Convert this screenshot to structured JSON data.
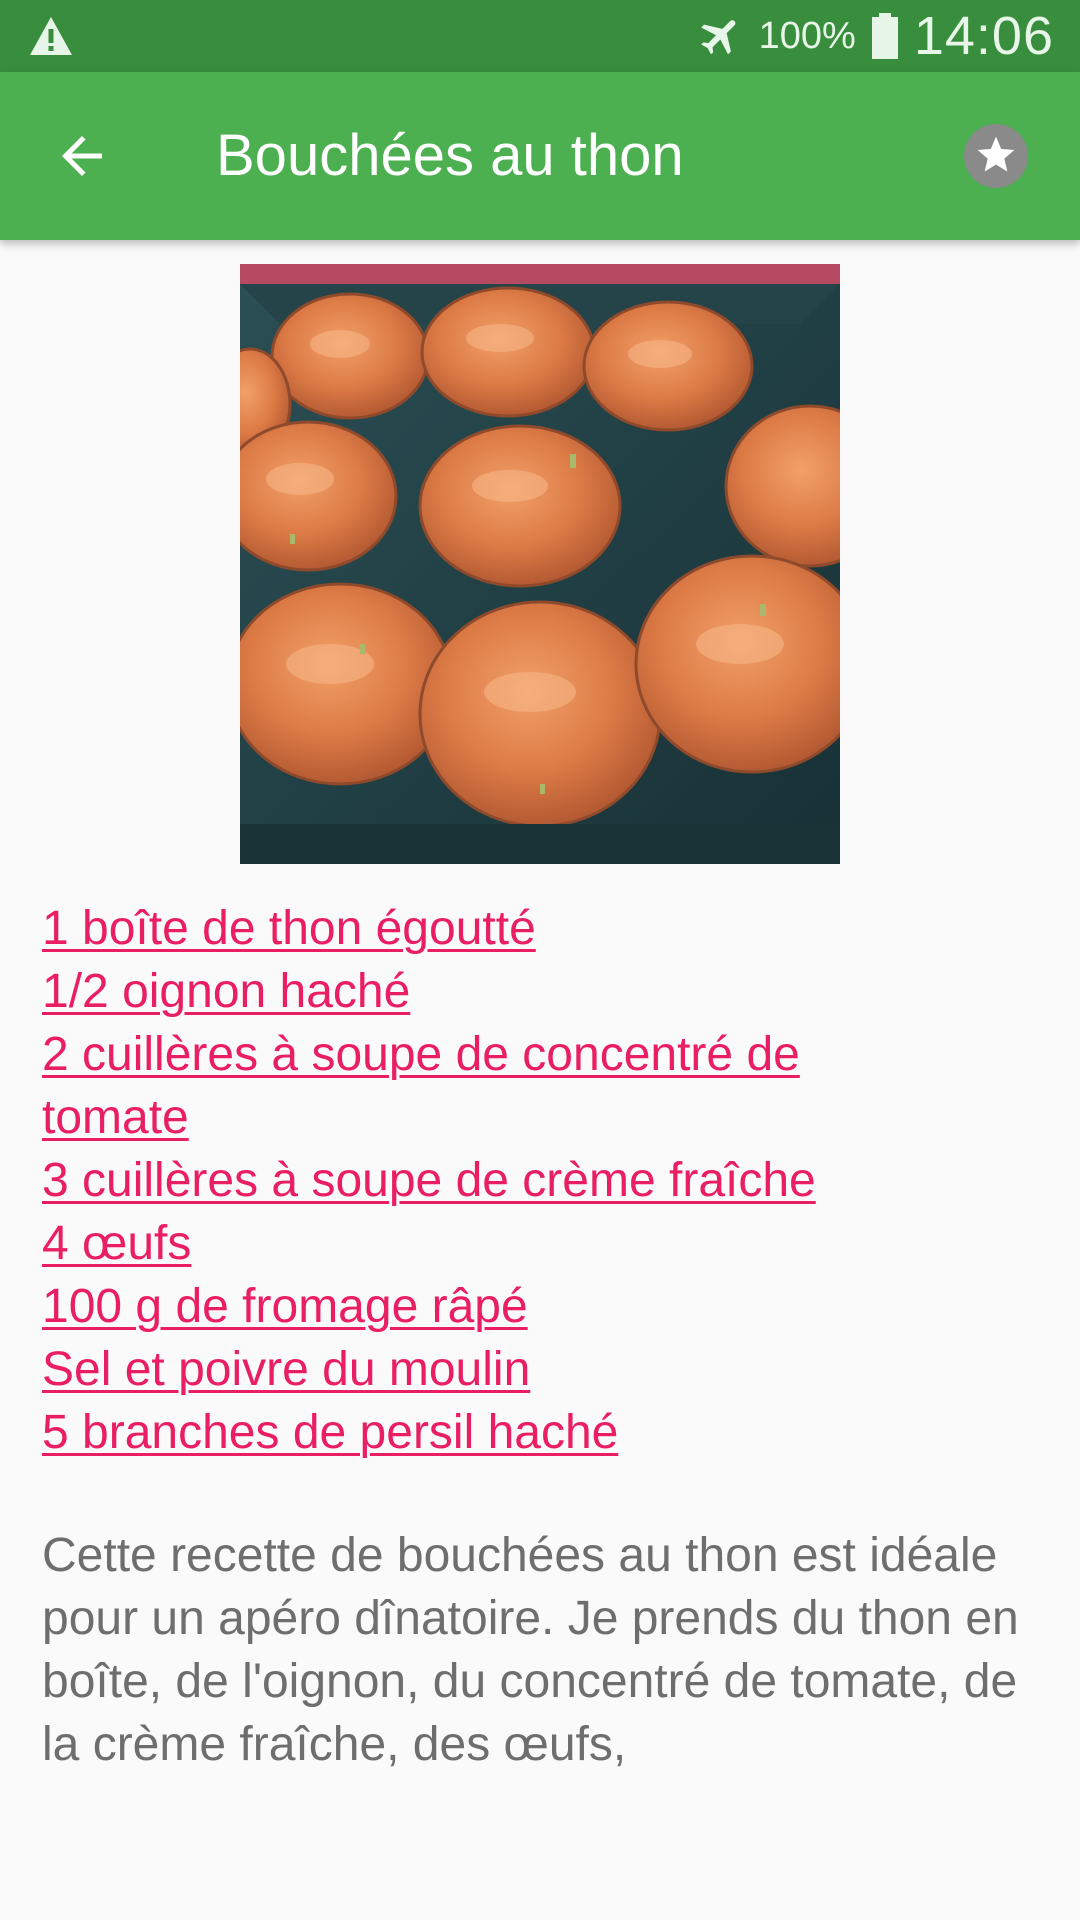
{
  "status_bar": {
    "battery_percent": "100%",
    "time": "14:06",
    "icons": [
      "warning-icon",
      "airplane-mode-icon",
      "battery-icon"
    ]
  },
  "app_bar": {
    "title": "Bouchées au thon",
    "icons": [
      "back-arrow-icon",
      "favorite-star-icon"
    ]
  },
  "colors": {
    "status_bar": "#388e3c",
    "app_bar": "#4caf50",
    "ingredient_link": "#e91e63",
    "body_text": "#6e6e6e",
    "background": "#fafafa"
  },
  "ingredients": [
    "1 boîte de thon égoutté",
    "1/2 oignon haché",
    "2 cuillères à soupe de concentré de tomate",
    "3 cuillères à soupe de crème fraîche",
    "4 œufs",
    "100 g de fromage râpé",
    "Sel et poivre du moulin",
    "5 branches de persil haché"
  ],
  "description": "Cette recette de bouchées au thon est idéale pour un apéro dînatoire. Je prends du thon en boîte, de l'oignon, du concentré de tomate, de la crème fraîche, des œufs,"
}
